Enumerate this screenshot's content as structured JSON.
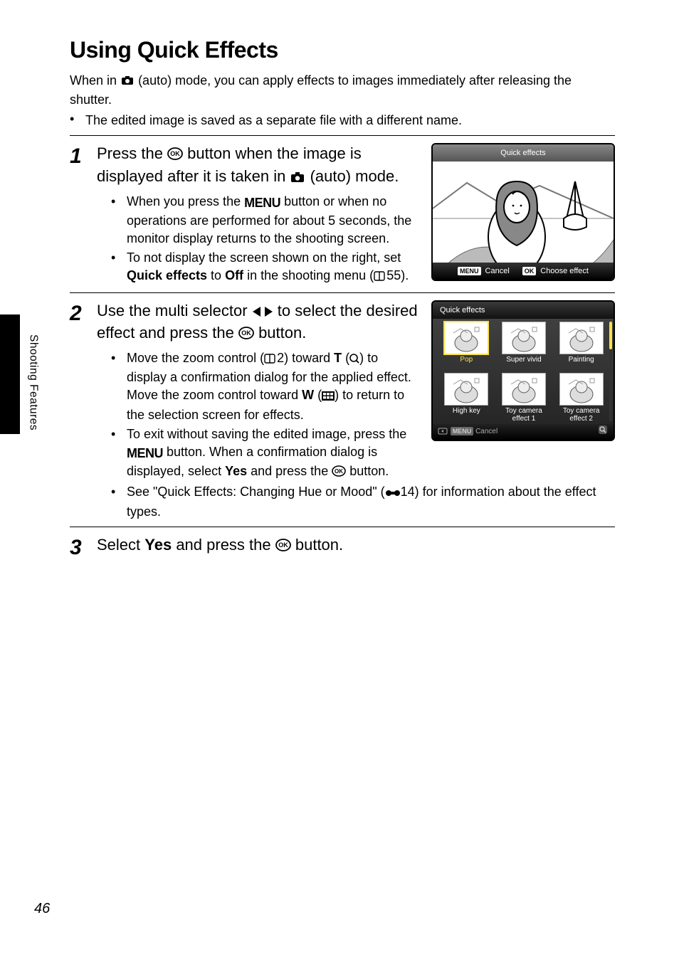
{
  "sideLabel": "Shooting Features",
  "pageNumber": "46",
  "title": "Using Quick Effects",
  "introLine1a": "When in ",
  "introLine1b": " (auto) mode, you can apply effects to images immediately after releasing the shutter.",
  "introBullet": "The edited image is saved as a separate file with a different name.",
  "step1": {
    "num": "1",
    "headA": "Press the ",
    "headB": " button when the image is displayed after it is taken in ",
    "headC": " (auto) mode.",
    "b1a": "When you press the ",
    "b1b": " button or when no operations are performed for about 5 seconds, the monitor display returns to the shooting screen.",
    "b2a": "To not display the screen shown on the right, set ",
    "b2b": "Quick effects",
    "b2c": " to ",
    "b2d": "Off",
    "b2e": " in the shooting menu (",
    "b2f": "55)."
  },
  "shot1": {
    "title": "Quick effects",
    "cancelChip": "MENU",
    "cancelText": "Cancel",
    "okChip": "OK",
    "okText": "Choose effect"
  },
  "step2": {
    "num": "2",
    "headA": "Use the multi selector ",
    "headB": " to select the desired effect and press the ",
    "headC": " button.",
    "b1a": "Move the zoom control (",
    "b1b": "2) toward ",
    "b1c": "T",
    "b1d": " (",
    "b1e": ") to display a confirmation dialog for the applied effect. Move the zoom control toward ",
    "b1f": "W",
    "b1g": " (",
    "b1h": ") to return to the selection screen for effects.",
    "b2a": "To exit without saving the edited image, press the ",
    "b2b": " button. When a confirmation dialog is displayed, select ",
    "b2c": "Yes",
    "b2d": " and press the ",
    "b2e": " button.",
    "b3a": "See \"Quick Effects: Changing Hue or Mood\" (",
    "b3b": "14) for information about the effect types."
  },
  "shot2": {
    "title": "Quick effects",
    "thumbs": [
      {
        "label": "Pop",
        "selected": true
      },
      {
        "label": "Super vivid"
      },
      {
        "label": "Painting"
      },
      {
        "label": "High key"
      },
      {
        "label": "Toy camera effect 1"
      },
      {
        "label": "Toy camera effect 2"
      }
    ],
    "cancelChip": "MENU",
    "cancelText": "Cancel"
  },
  "step3": {
    "num": "3",
    "headA": "Select ",
    "headB": "Yes",
    "headC": " and press the ",
    "headD": " button."
  }
}
